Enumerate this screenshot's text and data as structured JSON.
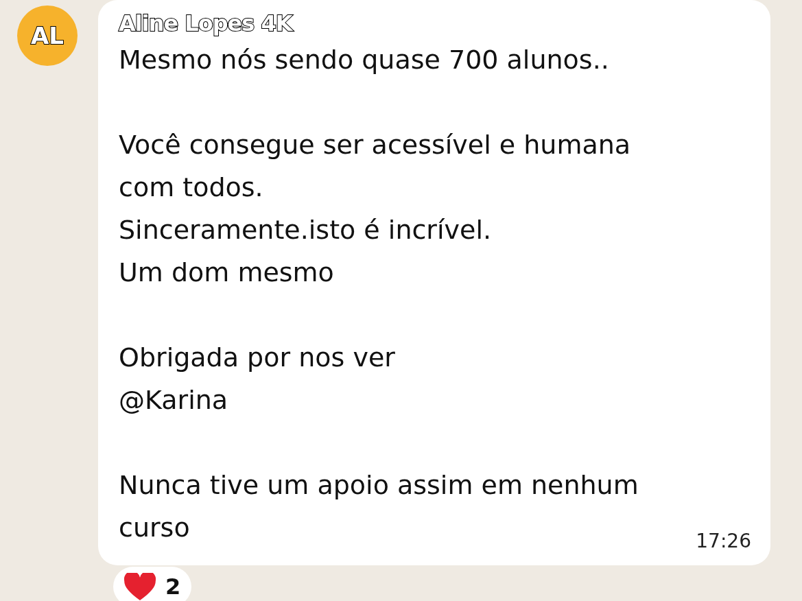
{
  "message": {
    "avatar_initials": "AL",
    "sender": "Aline Lopes 4K",
    "paragraphs": [
      [
        "Mesmo nós sendo quase 700 alunos.."
      ],
      [
        "Você consegue ser acessível e humana",
        "com todos.",
        "Sinceramente.isto é incrível.",
        "Um dom mesmo"
      ],
      [
        "Obrigada por nos ver",
        "@Karina"
      ],
      [
        "Nunca tive um apoio assim em nenhum",
        "curso"
      ]
    ],
    "time": "17:26",
    "reactions": [
      {
        "count": "2"
      }
    ]
  }
}
